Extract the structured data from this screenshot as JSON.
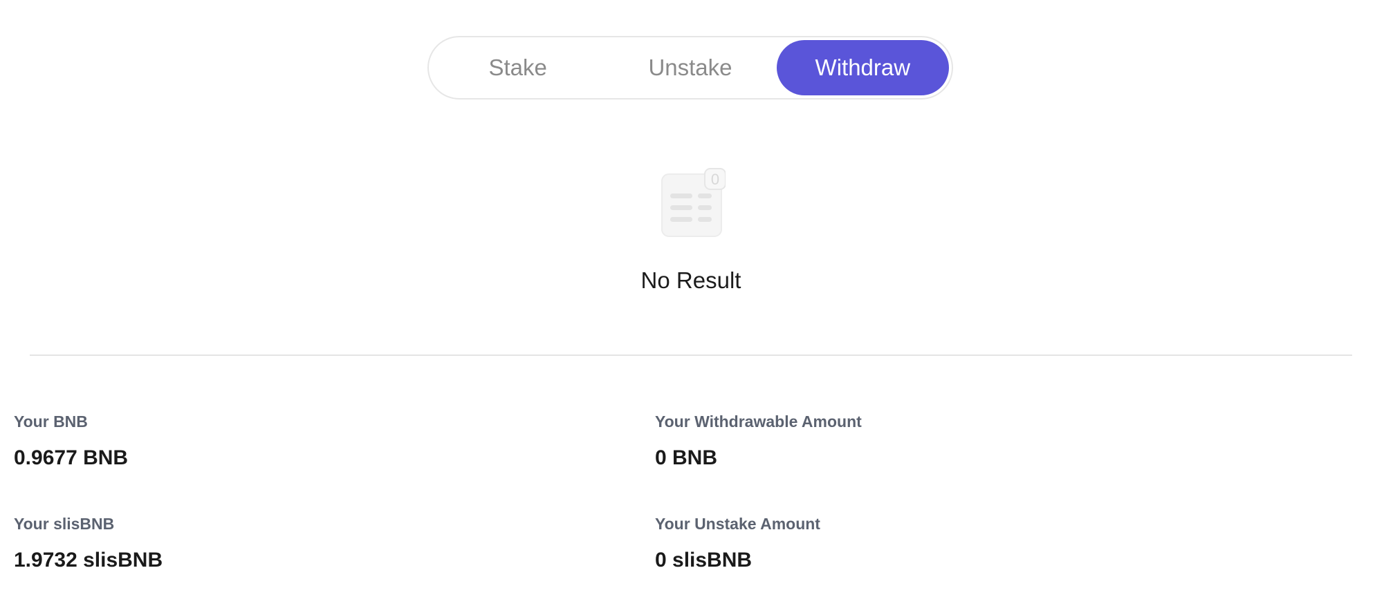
{
  "tabs": [
    {
      "label": "Stake",
      "active": false
    },
    {
      "label": "Unstake",
      "active": false
    },
    {
      "label": "Withdraw",
      "active": true
    }
  ],
  "empty_state": {
    "icon": "empty-list-icon",
    "badge": "0",
    "message": "No Result"
  },
  "stats": {
    "bnb": {
      "label": "Your BNB",
      "value": "0.9677 BNB"
    },
    "withdrawable": {
      "label": "Your Withdrawable Amount",
      "value": "0 BNB"
    },
    "slisbnb": {
      "label": "Your slisBNB",
      "value": "1.9732 slisBNB"
    },
    "unstake": {
      "label": "Your Unstake Amount",
      "value": "0 slisBNB"
    }
  },
  "colors": {
    "accent": "#5a55d9",
    "tab_inactive_text": "#8a8a8a",
    "label_text": "#5b6270",
    "value_text": "#1a1a1a"
  }
}
